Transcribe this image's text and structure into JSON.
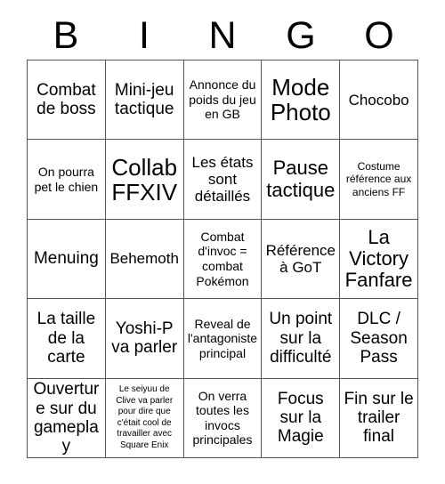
{
  "card": {
    "title_letters": [
      "B",
      "I",
      "N",
      "G",
      "O"
    ],
    "grid_size": "5x5",
    "colors": {
      "text": "#000000",
      "grid_line": "#555555",
      "background": "#ffffff"
    },
    "rows": [
      [
        {
          "text": "Combat de boss",
          "size": "lg"
        },
        {
          "text": "Mini-jeu tactique",
          "size": "lg"
        },
        {
          "text": "Annonce du poids du jeu en GB",
          "size": "sm"
        },
        {
          "text": "Mode Photo",
          "size": "xxl"
        },
        {
          "text": "Chocobo",
          "size": "md"
        }
      ],
      [
        {
          "text": "On pourra pet le chien",
          "size": "sm"
        },
        {
          "text": "Collab FFXIV",
          "size": "xxl"
        },
        {
          "text": "Les états sont détaillés",
          "size": "md"
        },
        {
          "text": "Pause tactique",
          "size": "xl"
        },
        {
          "text": "Costume référence aux anciens FF",
          "size": "xs"
        }
      ],
      [
        {
          "text": "Menuing",
          "size": "lg"
        },
        {
          "text": "Behemoth",
          "size": "md"
        },
        {
          "text": "Combat d'invoc = combat Pokémon",
          "size": "sm"
        },
        {
          "text": "Référence à GoT",
          "size": "md"
        },
        {
          "text": "La Victory Fanfare",
          "size": "xl"
        }
      ],
      [
        {
          "text": "La taille de la carte",
          "size": "lg"
        },
        {
          "text": "Yoshi-P va parler",
          "size": "lg"
        },
        {
          "text": "Reveal de l'antagoniste principal",
          "size": "sm"
        },
        {
          "text": "Un point sur la difficulté",
          "size": "lg"
        },
        {
          "text": "DLC / Season Pass",
          "size": "lg"
        }
      ],
      [
        {
          "text": "Ouverture sur du gameplay",
          "size": "lg"
        },
        {
          "text": "Le seiyuu de Clive va parler pour dire que c'était cool de travailler avec Square Enix",
          "size": "xxs"
        },
        {
          "text": "On verra toutes les invocs principales",
          "size": "sm"
        },
        {
          "text": "Focus sur la Magie",
          "size": "lg"
        },
        {
          "text": "Fin sur le trailer final",
          "size": "lg"
        }
      ]
    ]
  }
}
